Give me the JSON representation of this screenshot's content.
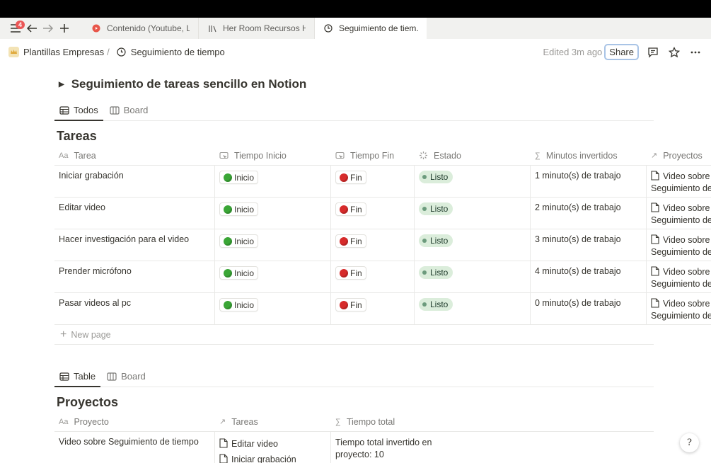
{
  "tabbar": {
    "badge": "4",
    "tabs": [
      {
        "label": "Contenido (Youtube, LI",
        "icon": "youtube-icon"
      },
      {
        "label": "Her Room Recursos Hum",
        "icon": "database-icon"
      },
      {
        "label": "Seguimiento de tiem...",
        "icon": "clock-icon"
      }
    ]
  },
  "navbar": {
    "workspace": "Plantillas Empresas",
    "separator": "/",
    "page": "Seguimiento de tiempo",
    "edited": "Edited 3m ago",
    "share": "Share"
  },
  "toggle_heading": "Seguimiento de tareas sencillo en Notion",
  "view_tabs_1": [
    {
      "label": "Todos",
      "active": true,
      "icon": "table-icon"
    },
    {
      "label": "Board",
      "active": false,
      "icon": "board-icon"
    }
  ],
  "tareas": {
    "title": "Tareas",
    "columns": [
      {
        "label": "Tarea",
        "icon_text": "Aa"
      },
      {
        "label": "Tiempo Inicio",
        "icon": "button-icon"
      },
      {
        "label": "Tiempo Fin",
        "icon": "button-icon"
      },
      {
        "label": "Estado",
        "icon": "status-icon"
      },
      {
        "label": "Minutos invertidos",
        "icon_text": "∑"
      },
      {
        "label": "Proyectos",
        "icon_text": "↗"
      }
    ],
    "rows": [
      {
        "tarea": "Iniciar grabación",
        "inicio": "Inicio",
        "fin": "Fin",
        "estado": "Listo",
        "minutos": "1 minuto(s) de trabajo",
        "proyecto_line1": "Video sobre",
        "proyecto_line2": "Seguimiento de"
      },
      {
        "tarea": "Editar video",
        "inicio": "Inicio",
        "fin": "Fin",
        "estado": "Listo",
        "minutos": "2 minuto(s) de trabajo",
        "proyecto_line1": "Video sobre",
        "proyecto_line2": "Seguimiento de"
      },
      {
        "tarea": "Hacer investigación para el video",
        "inicio": "Inicio",
        "fin": "Fin",
        "estado": "Listo",
        "minutos": "3 minuto(s) de trabajo",
        "proyecto_line1": "Video sobre",
        "proyecto_line2": "Seguimiento de"
      },
      {
        "tarea": "Prender micrófono",
        "inicio": "Inicio",
        "fin": "Fin",
        "estado": "Listo",
        "minutos": "4 minuto(s) de trabajo",
        "proyecto_line1": "Video sobre",
        "proyecto_line2": "Seguimiento de"
      },
      {
        "tarea": "Pasar videos al pc",
        "inicio": "Inicio",
        "fin": "Fin",
        "estado": "Listo",
        "minutos": "0 minuto(s) de trabajo",
        "proyecto_line1": "Video sobre",
        "proyecto_line2": "Seguimiento de"
      }
    ],
    "new_page": "New page"
  },
  "view_tabs_2": [
    {
      "label": "Table",
      "active": true,
      "icon": "table-icon"
    },
    {
      "label": "Board",
      "active": false,
      "icon": "board-icon"
    }
  ],
  "proyectos": {
    "title": "Proyectos",
    "columns": [
      {
        "label": "Proyecto",
        "icon_text": "Aa"
      },
      {
        "label": "Tareas",
        "icon_text": "↗"
      },
      {
        "label": "Tiempo total",
        "icon_text": "∑"
      }
    ],
    "rows": [
      {
        "proyecto": "Video sobre Seguimiento de tiempo",
        "tarea1": "Editar video",
        "tarea2": "Iniciar grabación",
        "total_line1": "Tiempo total invertido en",
        "total_line2": "proyecto: 10"
      }
    ]
  },
  "help": "?"
}
